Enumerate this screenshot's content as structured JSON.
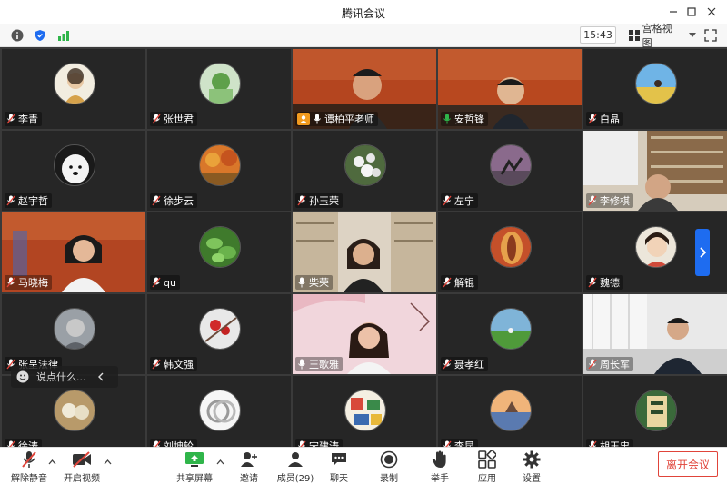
{
  "window": {
    "title": "腾讯会议"
  },
  "toolbar": {
    "time": "15:43",
    "view_label": "宫格视图"
  },
  "participants": [
    {
      "name": "李青"
    },
    {
      "name": "张世君"
    },
    {
      "name": "谭柏平老师"
    },
    {
      "name": "安哲锋"
    },
    {
      "name": "白晶"
    },
    {
      "name": "赵宇哲"
    },
    {
      "name": "徐步云"
    },
    {
      "name": "孙玉荣"
    },
    {
      "name": "左宁"
    },
    {
      "name": "李修棋"
    },
    {
      "name": "马晓梅"
    },
    {
      "name": "qu"
    },
    {
      "name": "柴荣"
    },
    {
      "name": "解锟"
    },
    {
      "name": "魏德"
    },
    {
      "name": "张呈法律"
    },
    {
      "name": "韩文强"
    },
    {
      "name": "王歌雅"
    },
    {
      "name": "聂孝红"
    },
    {
      "name": "周长军"
    },
    {
      "name": "徐涛"
    },
    {
      "name": "刘坤轮"
    },
    {
      "name": "宋建涛"
    },
    {
      "name": "李昆"
    },
    {
      "name": "胡玉忠"
    }
  ],
  "chat": {
    "placeholder": "说点什么..."
  },
  "bottom": {
    "unmute": "解除静音",
    "start_video": "开启视频",
    "share_screen": "共享屏幕",
    "invite": "邀请",
    "members": "成员(29)",
    "chat": "聊天",
    "record": "录制",
    "raise_hand": "举手",
    "apps": "应用",
    "settings": "设置",
    "leave": "离开会议"
  },
  "colors": {
    "accent": "#1e6cf0",
    "leave": "#e0443a",
    "host_badge": "#f39a1e",
    "muted_mic": "#e0443a"
  }
}
